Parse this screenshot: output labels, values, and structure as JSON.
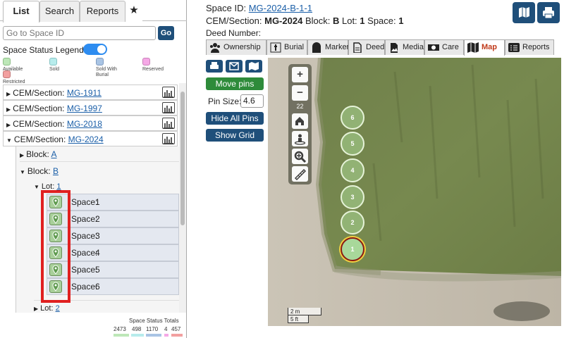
{
  "left_tabs": {
    "list": "List",
    "search": "Search",
    "reports": "Reports",
    "star": "★"
  },
  "goto": {
    "placeholder": "Go to Space ID",
    "button": "Go"
  },
  "legend": {
    "title": "Space Status Legend:",
    "items": [
      {
        "label": "Available",
        "color": "#bde7b8"
      },
      {
        "label": "Sold",
        "color": "#b7ecec"
      },
      {
        "label": "Sold With Burial",
        "color": "#a9c4e4"
      },
      {
        "label": "Reserved",
        "color": "#f5a8e6"
      },
      {
        "label": "Restricted",
        "color": "#f2a0a0"
      }
    ]
  },
  "tree": {
    "cem_prefix": "CEM/Section:",
    "sections": [
      "MG-1911",
      "MG-1997",
      "MG-2018",
      "MG-2024"
    ],
    "block_prefix": "Block:",
    "blocks": [
      "A",
      "B"
    ],
    "lot_prefix": "Lot:",
    "lots": [
      "1",
      "2"
    ],
    "space_prefix": "Space:",
    "spaces": [
      "1",
      "2",
      "3",
      "4",
      "5",
      "6"
    ]
  },
  "totals": {
    "title": "Space Status Totals",
    "values": [
      "2473",
      "498",
      "1170",
      "4",
      "457"
    ]
  },
  "detail": {
    "space_id_label": "Space ID:",
    "space_id": "MG-2024-B-1-1",
    "cem_label": "CEM/Section:",
    "cem": "MG-2024",
    "block_label": "Block:",
    "block": "B",
    "lot_label": "Lot:",
    "lot": "1",
    "space_label": "Space:",
    "space": "1",
    "deed_label": "Deed Number:"
  },
  "detail_tabs": [
    {
      "label": "Ownership",
      "icon": "people-icon"
    },
    {
      "label": "Burial",
      "icon": "burial-icon"
    },
    {
      "label": "Marker",
      "icon": "headstone-icon"
    },
    {
      "label": "Deed",
      "icon": "document-icon"
    },
    {
      "label": "Media",
      "icon": "image-icon"
    },
    {
      "label": "Care",
      "icon": "money-icon"
    },
    {
      "label": "Map",
      "icon": "map-icon"
    },
    {
      "label": "Reports",
      "icon": "list-icon"
    }
  ],
  "map_tools": {
    "move_pins": "Move pins",
    "pin_size_label": "Pin Size:",
    "pin_size": "4.6",
    "hide_pins": "Hide All Pins",
    "show_grid": "Show Grid"
  },
  "map": {
    "zoom_in": "+",
    "zoom_out": "−",
    "zoom_level": "22",
    "pins": [
      "6",
      "5",
      "4",
      "3",
      "2",
      "1"
    ],
    "selected_pin": "1",
    "scale_metric": "2 m",
    "scale_imperial": "5 ft"
  },
  "colors": {
    "accent": "#1f4f7a",
    "move_pins": "#2e8b3a",
    "active_tab": "#c03a1a",
    "highlight": "#e02020"
  }
}
